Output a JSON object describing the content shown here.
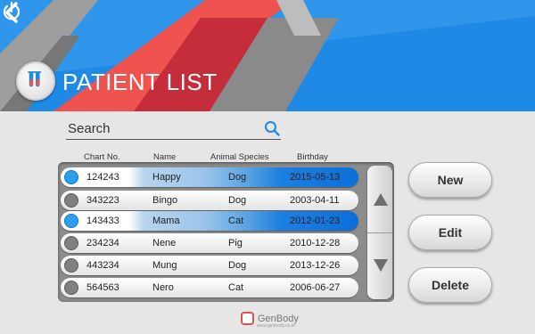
{
  "header": {
    "title": "PATIENT LIST",
    "back_icon": "chevron-left-icon",
    "power_icon": "power-icon",
    "logo_icon": "test-tubes-icon"
  },
  "search": {
    "label": "Search",
    "icon": "search-icon"
  },
  "table": {
    "columns": [
      "Chart No.",
      "Name",
      "Animal Species",
      "Birthday"
    ],
    "rows": [
      {
        "chart_no": "124243",
        "name": "Happy",
        "species": "Dog",
        "birthday": "2015-05-13",
        "selected": true
      },
      {
        "chart_no": "343223",
        "name": "Bingo",
        "species": "Dog",
        "birthday": "2003-04-11",
        "selected": false
      },
      {
        "chart_no": "143433",
        "name": "Mama",
        "species": "Cat",
        "birthday": "2012-01-23",
        "selected": true
      },
      {
        "chart_no": "234234",
        "name": "Nene",
        "species": "Pig",
        "birthday": "2010-12-28",
        "selected": false
      },
      {
        "chart_no": "443234",
        "name": "Mung",
        "species": "Dog",
        "birthday": "2013-12-26",
        "selected": false
      },
      {
        "chart_no": "564563",
        "name": "Nero",
        "species": "Cat",
        "birthday": "2006-06-27",
        "selected": false
      }
    ]
  },
  "scroll": {
    "up_icon": "triangle-up-icon",
    "down_icon": "triangle-down-icon"
  },
  "actions": {
    "new_label": "New",
    "edit_label": "Edit",
    "delete_label": "Delete"
  },
  "brand": {
    "name": "GenBody",
    "url": "www.genbody.co.kr"
  },
  "colors": {
    "accent_blue": "#1f8ae6",
    "selected_blue": "#0c6fd8",
    "ribbon_red": "#ef5350",
    "ribbon_gray": "#8a8a8a"
  }
}
